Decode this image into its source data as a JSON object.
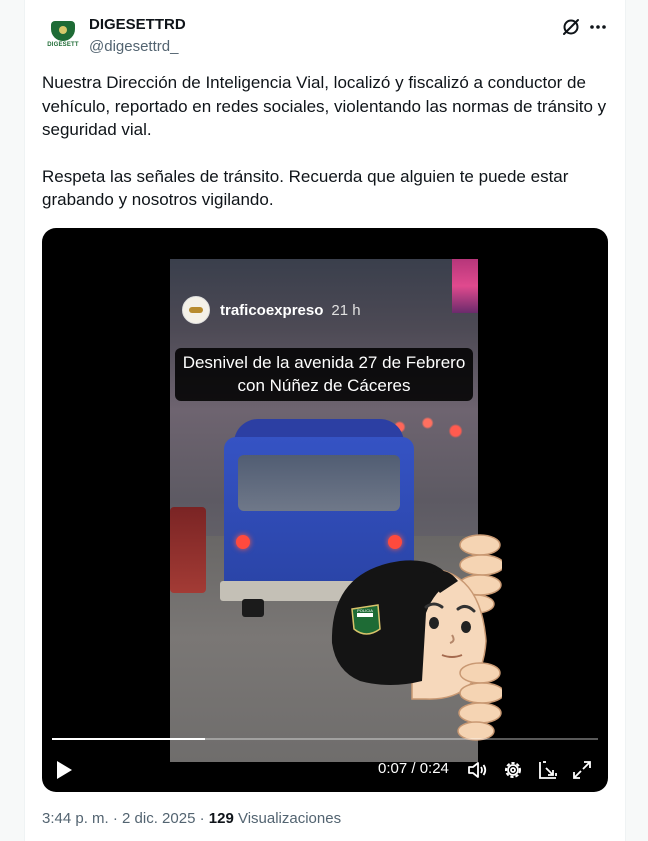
{
  "author": {
    "name": "DIGESETTRD",
    "handle": "@digesettrd_",
    "avatar_label": "DIGESETT"
  },
  "tweet": {
    "paragraph_1": "Nuestra Dirección de Inteligencia Vial, localizó y fiscalizó a conductor de vehículo, reportado en redes sociales, violentando las normas de tránsito y seguridad vial.",
    "paragraph_2": "Respeta las señales de tránsito. Recuerda que alguien te puede estar grabando y nosotros vigilando."
  },
  "video": {
    "story_account": "traficoexpreso",
    "story_time": "21 h",
    "caption_line_1": "Desnivel de la avenida 27 de Febrero",
    "caption_line_2": "con Núñez de Cáceres",
    "time_display": "0:07 / 0:24",
    "progress": 0.28,
    "badge_text": "POLICIA"
  },
  "meta": {
    "timestamp": "3:44 p. m. · 2 dic. 2025 · ",
    "views_count": "129",
    "views_label": " Visualizaciones"
  },
  "icons": {
    "header": [
      "grok-icon",
      "more-icon"
    ],
    "player": [
      "play-icon",
      "volume-icon",
      "settings-icon",
      "popout-icon",
      "fullscreen-icon"
    ]
  },
  "colors": {
    "brand_green": "#1e6b35",
    "text_primary": "#0f1419",
    "text_secondary": "#536471",
    "bus_blue": "#2a44a7"
  }
}
